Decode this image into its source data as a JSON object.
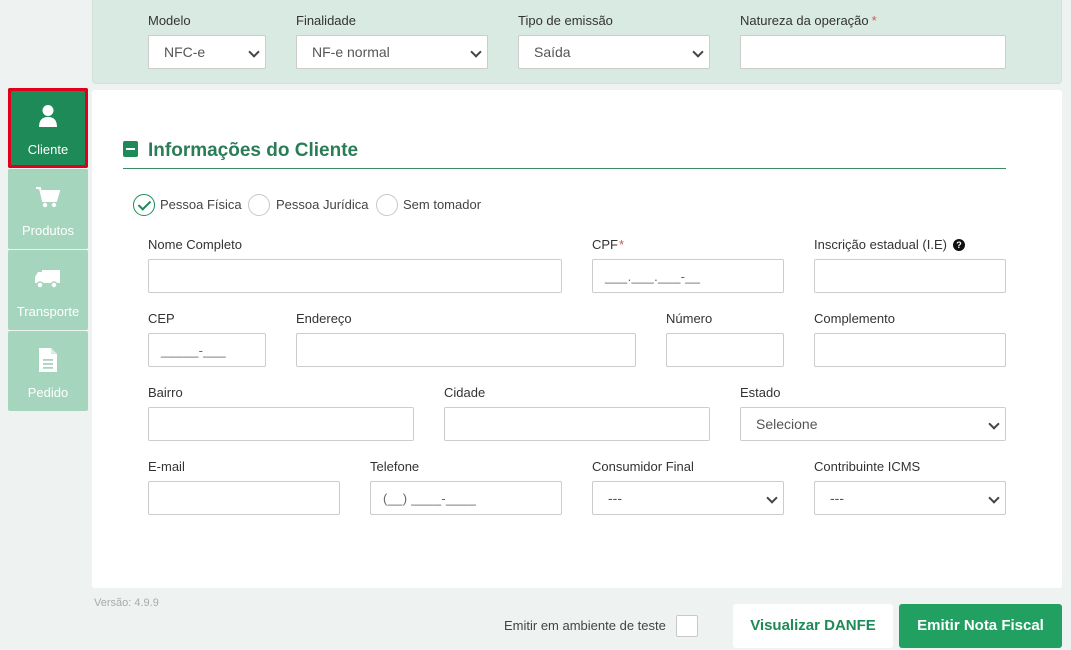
{
  "top": {
    "modelo_label": "Modelo",
    "modelo_value": "NFC-e",
    "finalidade_label": "Finalidade",
    "finalidade_value": "NF-e normal",
    "tipo_label": "Tipo de emissão",
    "tipo_value": "Saída",
    "natureza_label": "Natureza da operação",
    "natureza_value": "",
    "required_mark": "*"
  },
  "sidebar": {
    "items": [
      {
        "label": "Cliente",
        "icon": "user-icon"
      },
      {
        "label": "Produtos",
        "icon": "cart-icon"
      },
      {
        "label": "Transporte",
        "icon": "truck-icon"
      },
      {
        "label": "Pedido",
        "icon": "document-icon"
      }
    ]
  },
  "section": {
    "title": "Informações do Cliente",
    "radios": [
      "Pessoa Física",
      "Pessoa Jurídica",
      "Sem tomador"
    ],
    "selected_radio": "Pessoa Física"
  },
  "fields": {
    "nome_label": "Nome Completo",
    "cpf_label": "CPF",
    "cpf_mask": "___.___.___-__",
    "ie_label": "Inscrição estadual (I.E)",
    "ie_help": "?",
    "cep_label": "CEP",
    "cep_mask": "_____-___",
    "endereco_label": "Endereço",
    "numero_label": "Número",
    "complemento_label": "Complemento",
    "bairro_label": "Bairro",
    "cidade_label": "Cidade",
    "estado_label": "Estado",
    "estado_value": "Selecione",
    "email_label": "E-mail",
    "telefone_label": "Telefone",
    "telefone_mask": "(__) ____-____",
    "consumidor_label": "Consumidor Final",
    "consumidor_value": "---",
    "contribuinte_label": "Contribuinte ICMS",
    "contribuinte_value": "---"
  },
  "footer": {
    "version": "Versão: 4.9.9",
    "test_label": "Emitir em ambiente de teste",
    "danfe_button": "Visualizar DANFE",
    "emit_button": "Emitir Nota Fiscal"
  },
  "colors": {
    "accent": "#1e8a57",
    "sidebar_inactive": "#a6d5bd",
    "highlight_border": "#e0001b"
  }
}
